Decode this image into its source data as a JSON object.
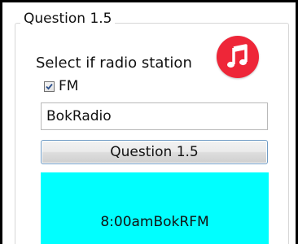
{
  "group": {
    "title": "Question 1.5"
  },
  "prompt_label": "Select if radio station",
  "music_icon": {
    "icon": "music-note-icon",
    "color": "#ee2638"
  },
  "fm_checkbox": {
    "label": "FM",
    "checked": true
  },
  "station_input": {
    "value": "BokRadio"
  },
  "action_button": {
    "label": "Question 1.5"
  },
  "output": {
    "text": "8:00amBokRFM",
    "background": "#00ffff"
  }
}
